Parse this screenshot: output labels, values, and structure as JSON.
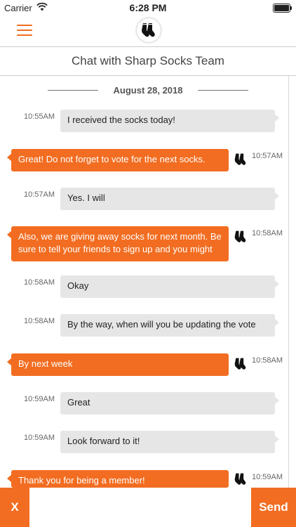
{
  "status_bar": {
    "carrier": "Carrier",
    "time": "6:28 PM"
  },
  "header": {
    "logo_icon": "socks-logo-icon",
    "menu_icon": "hamburger-menu-icon"
  },
  "chat": {
    "title": "Chat with Sharp Socks Team",
    "date": "August 28, 2018",
    "messages": [
      {
        "side": "in",
        "time": "10:55AM",
        "text": "I received the socks today!"
      },
      {
        "side": "out",
        "time": "10:57AM",
        "text": "Great! Do not forget to vote for the next socks."
      },
      {
        "side": "in",
        "time": "10:57AM",
        "text": "Yes. I will"
      },
      {
        "side": "out",
        "time": "10:58AM",
        "text": "Also, we are giving away socks for next month. Be sure to tell your friends to sign up and you might"
      },
      {
        "side": "in",
        "time": "10:58AM",
        "text": "Okay"
      },
      {
        "side": "in",
        "time": "10:58AM",
        "text": "By the way, when will you be updating the vote"
      },
      {
        "side": "out",
        "time": "10:58AM",
        "text": "By next week"
      },
      {
        "side": "in",
        "time": "10:59AM",
        "text": "Great"
      },
      {
        "side": "in",
        "time": "10:59AM",
        "text": "Look forward to it!"
      },
      {
        "side": "out",
        "time": "10:59AM",
        "text": "Thank you for being a member!"
      }
    ]
  },
  "composer": {
    "cancel_label": "X",
    "send_label": "Send",
    "placeholder": ""
  },
  "colors": {
    "accent": "#f26d21",
    "incoming_bubble": "#e6e6e6"
  }
}
